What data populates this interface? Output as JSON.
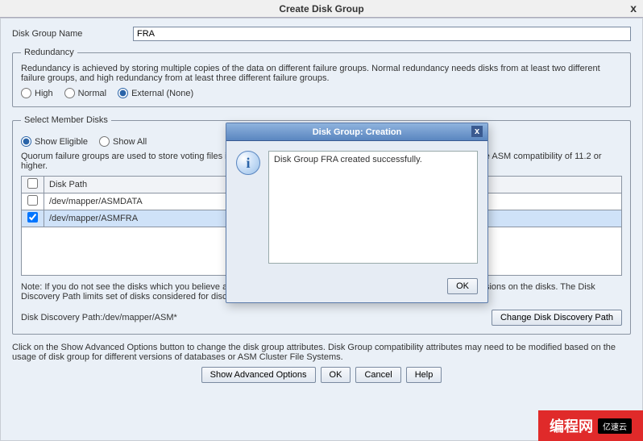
{
  "window": {
    "title": "Create Disk Group",
    "close_glyph": "x"
  },
  "form": {
    "disk_group_name_label": "Disk Group Name",
    "disk_group_name_value": "FRA"
  },
  "redundancy": {
    "legend": "Redundancy",
    "desc": "Redundancy is achieved by storing multiple copies of the data on different failure groups. Normal redundancy needs disks from at least two different failure groups, and high redundancy from at least three different failure groups.",
    "options": {
      "high": "High",
      "normal": "Normal",
      "external": "External (None)"
    },
    "selected": "external"
  },
  "member_disks": {
    "legend": "Select Member Disks",
    "show_options": {
      "eligible": "Show Eligible",
      "all": "Show All"
    },
    "show_selected": "eligible",
    "quorum_desc": "Quorum failure groups are used to store voting files in extended clusters and do not contain any user data. They require ASM compatibility of 11.2 or higher.",
    "table": {
      "header": "Disk Path",
      "rows": [
        {
          "path": "/dev/mapper/ASMDATA",
          "checked": false
        },
        {
          "path": "/dev/mapper/ASMFRA",
          "checked": true
        }
      ]
    },
    "note": "Note: If you do not see the disks which you believe are available, check the Disk Discovery Path and read/write permissions on the disks. The Disk Discovery Path limits set of disks considered for discovery.",
    "discovery_label": "Disk Discovery Path:/dev/mapper/ASM*",
    "change_path_btn": "Change Disk Discovery Path"
  },
  "footer": {
    "advanced_desc": "Click on the Show Advanced Options button to change the disk group attributes. Disk Group compatibility attributes may need to be modified based on the usage of disk group for different versions of databases or ASM Cluster File Systems.",
    "buttons": {
      "advanced": "Show Advanced Options",
      "ok": "OK",
      "cancel": "Cancel",
      "help": "Help"
    }
  },
  "modal": {
    "title": "Disk Group: Creation",
    "message": "Disk Group FRA created successfully.",
    "info_glyph": "i",
    "close_glyph": "x",
    "ok": "OK"
  },
  "watermark": {
    "text": "编程网",
    "side": "亿速云"
  }
}
